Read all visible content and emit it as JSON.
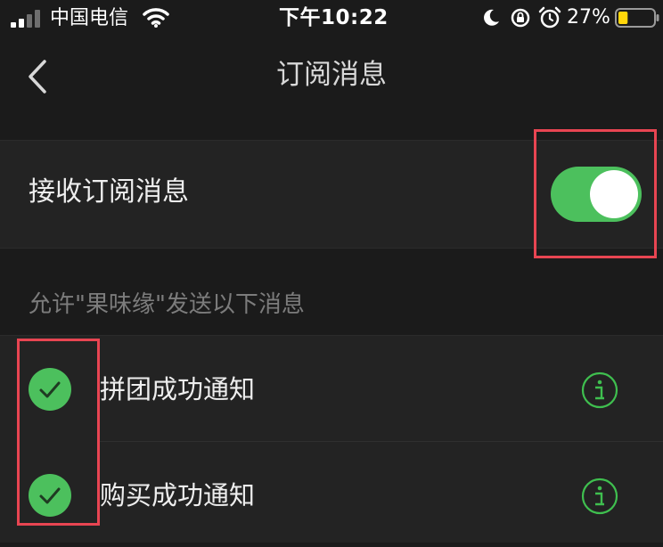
{
  "status_bar": {
    "carrier": "中国电信",
    "time": "下午10:22",
    "battery_percent": "27%",
    "battery_level": 0.27,
    "icons": [
      "signal-icon",
      "wifi-icon",
      "moon-icon",
      "rotation-lock-icon",
      "alarm-icon",
      "battery-icon"
    ]
  },
  "nav": {
    "title": "订阅消息",
    "back_icon": "chevron-left-icon"
  },
  "subscription": {
    "label": "接收订阅消息",
    "enabled": true
  },
  "section": {
    "caption": "允许\"果味缘\"发送以下消息"
  },
  "notifications": [
    {
      "label": "拼团成功通知",
      "checked": true,
      "info_icon": "info-icon"
    },
    {
      "label": "购买成功通知",
      "checked": true,
      "info_icon": "info-icon"
    }
  ],
  "colors": {
    "background": "#1b1b1b",
    "row_background": "#232323",
    "accent_green": "#4cc05d",
    "highlight_red": "#e84552",
    "caption_gray": "#7c7c7c"
  }
}
